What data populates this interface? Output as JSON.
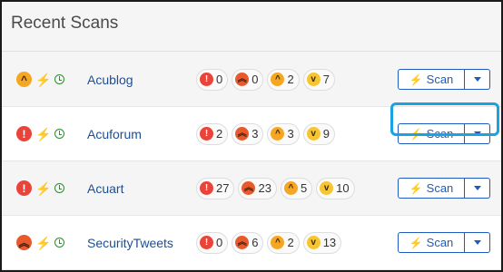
{
  "panel": {
    "title": "Recent Scans"
  },
  "scan_label": "Scan",
  "severity_icons": {
    "critical": "!",
    "high": "⏫",
    "medium": "⌃",
    "low": "⌄"
  },
  "rows": [
    {
      "name": "Acublog",
      "main_severity": "medium",
      "counts": {
        "critical": "0",
        "high": "0",
        "medium": "2",
        "low": "7"
      }
    },
    {
      "name": "Acuforum",
      "main_severity": "critical",
      "counts": {
        "critical": "2",
        "high": "3",
        "medium": "3",
        "low": "9"
      }
    },
    {
      "name": "Acuart",
      "main_severity": "critical",
      "counts": {
        "critical": "27",
        "high": "23",
        "medium": "5",
        "low": "10"
      }
    },
    {
      "name": "SecurityTweets",
      "main_severity": "high",
      "counts": {
        "critical": "0",
        "high": "6",
        "medium": "2",
        "low": "13"
      }
    }
  ],
  "colors": {
    "critical": "#e8443a",
    "high": "#e85a2c",
    "medium": "#f5a623",
    "low": "#f7c531",
    "accent": "#1f5bbf",
    "focus": "#1aa3e0"
  }
}
